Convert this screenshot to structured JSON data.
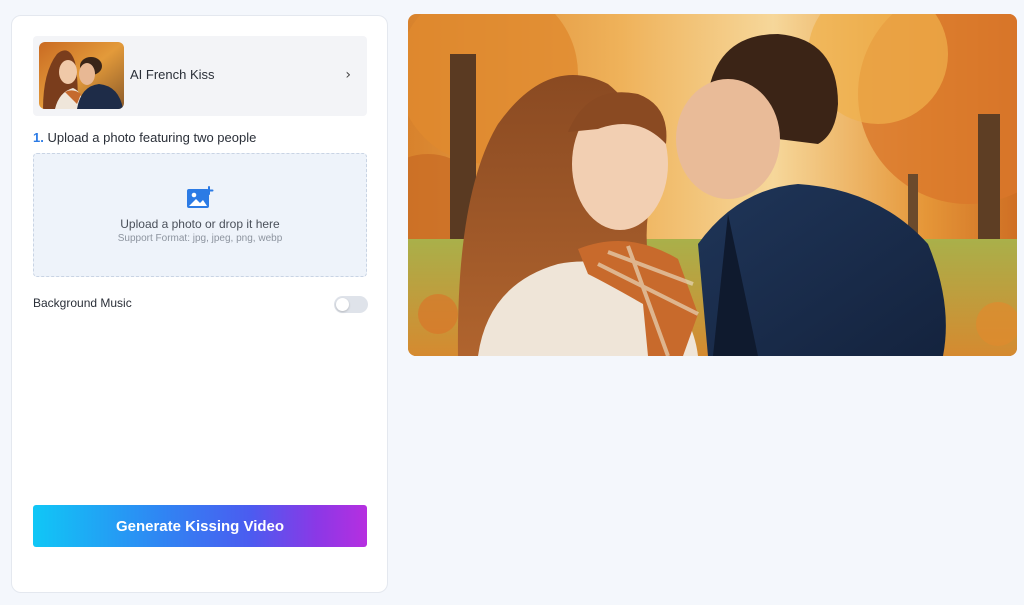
{
  "effect": {
    "name": "AI French Kiss",
    "thumbnail_icon": "couple-kiss-thumbnail"
  },
  "upload": {
    "step_number": "1.",
    "step_label": "Upload a photo featuring two people",
    "title": "Upload a photo or drop it here",
    "formats": "Support Format: jpg, jpeg, png, webp",
    "icon": "image-add-icon"
  },
  "background_music": {
    "label": "Background Music",
    "enabled": false
  },
  "generate_button": {
    "label": "Generate Kissing Video"
  },
  "preview": {
    "icon": "couple-kiss-autumn-image"
  },
  "colors": {
    "accent": "#2c7be5",
    "button_gradient": [
      "#10c7f6",
      "#2f86f3",
      "#8b38e6",
      "#b62fe0"
    ],
    "background": "#f4f7fc"
  }
}
